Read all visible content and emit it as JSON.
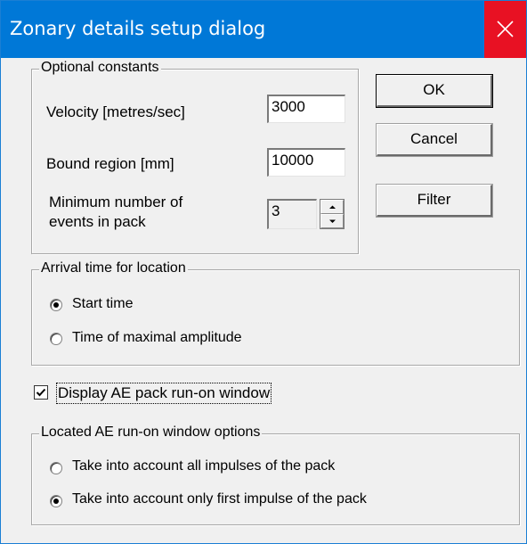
{
  "window": {
    "title": "Zonary details setup dialog"
  },
  "constants": {
    "legend": "Optional constants",
    "velocity_label": "Velocity [metres/sec]",
    "velocity_value": "3000",
    "bound_label": "Bound region [mm]",
    "bound_value": "10000",
    "min_events_label_line1": "Minimum number of",
    "min_events_label_line2": "events in pack",
    "min_events_value": "3"
  },
  "buttons": {
    "ok": "OK",
    "cancel": "Cancel",
    "filter": "Filter"
  },
  "arrival": {
    "legend": "Arrival time for location",
    "options": [
      {
        "label": "Start time",
        "selected": true
      },
      {
        "label": "Time of maximal amplitude",
        "selected": false
      }
    ]
  },
  "display_checkbox": {
    "label": "Display AE pack run-on window",
    "checked": true
  },
  "located": {
    "legend": "Located AE run-on window options",
    "options": [
      {
        "label": "Take into account all impulses of the pack",
        "selected": false
      },
      {
        "label": "Take into account only first impulse of the pack",
        "selected": true
      }
    ]
  },
  "colors": {
    "titlebar": "#0078d7",
    "close_button": "#e81123",
    "dialog_face": "#f0f0f0"
  },
  "icons": {
    "close": "close-icon",
    "spin_up": "spin-up-icon",
    "spin_down": "spin-down-icon",
    "check": "checkmark-icon"
  }
}
